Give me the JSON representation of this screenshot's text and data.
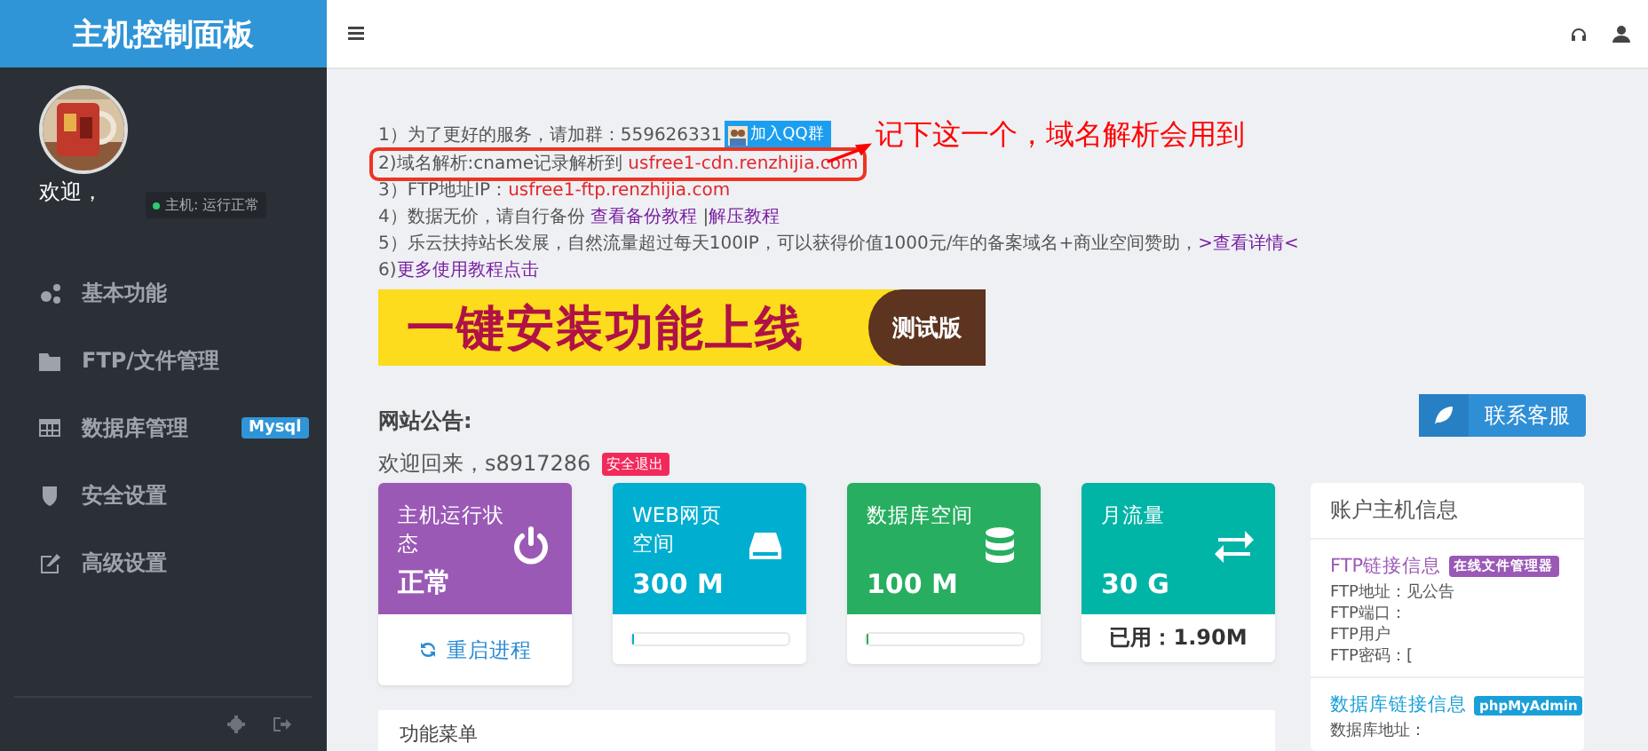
{
  "sidebar": {
    "title": "主机控制面板",
    "welcome": "欢迎，",
    "status": "主机: 运行正常",
    "items": [
      {
        "label": "基本功能"
      },
      {
        "label": "FTP/文件管理"
      },
      {
        "label": "数据库管理",
        "badge": "Mysql"
      },
      {
        "label": "安全设置"
      },
      {
        "label": "高级设置"
      }
    ]
  },
  "notices": [
    {
      "boxed": false,
      "parts": [
        {
          "kind": "text",
          "text": "1）为了更好的服务，请加群：559626331"
        },
        {
          "kind": "qq",
          "text": "加入QQ群"
        }
      ]
    },
    {
      "boxed": true,
      "parts": [
        {
          "kind": "text",
          "text": "2)域名解析:cname记录解析到 "
        },
        {
          "kind": "highlight",
          "text": "usfree1-cdn.renzhijia.com"
        }
      ]
    },
    {
      "boxed": false,
      "parts": [
        {
          "kind": "text",
          "text": "3）FTP地址IP："
        },
        {
          "kind": "highlight",
          "text": "usfree1-ftp.renzhijia.com"
        }
      ]
    },
    {
      "boxed": false,
      "parts": [
        {
          "kind": "text",
          "text": "4）数据无价，请自行备份 "
        },
        {
          "kind": "link",
          "text": "查看备份教程"
        },
        {
          "kind": "text",
          "text": " |"
        },
        {
          "kind": "link",
          "text": "解压教程"
        }
      ]
    },
    {
      "boxed": false,
      "parts": [
        {
          "kind": "text",
          "text": "5）乐云扶持站长发展，自然流量超过每天100IP，可以获得价值1000元/年的备案域名+商业空间赞助，"
        },
        {
          "kind": "link",
          "text": ">查看详情<"
        }
      ]
    },
    {
      "boxed": false,
      "parts": [
        {
          "kind": "text",
          "text": "6)"
        },
        {
          "kind": "link",
          "text": "更多使用教程点击"
        }
      ]
    }
  ],
  "annotation": "记下这一个，域名解析会用到",
  "banner": {
    "headline": "一键安装功能上线",
    "tag": "测试版"
  },
  "announcement": {
    "label": "网站公告:",
    "welcome": "欢迎回来，s8917286",
    "logout": "安全退出",
    "support_button": "联系客服"
  },
  "cards": [
    {
      "kind": "status",
      "title": "主机运行状态",
      "value": "正常",
      "footer": "重启进程",
      "color": "#9b59b6"
    },
    {
      "kind": "meter",
      "title": "WEB网页空间",
      "value": "300 M",
      "level": 0.01,
      "color": "#00aed0"
    },
    {
      "kind": "meter",
      "title": "数据库空间",
      "value": "100 M",
      "level": 0.02,
      "color": "#27ae60"
    },
    {
      "kind": "usage",
      "title": "月流量",
      "value": "30 G",
      "footer": "已用：1.90M",
      "color": "#00b5a6"
    }
  ],
  "account": {
    "title": "账户主机信息",
    "sections": [
      {
        "heading": "FTP链接信息",
        "badge": "在线文件管理器",
        "color": "#9b59b6",
        "lines": [
          "FTP地址：见公告",
          "FTP端口：",
          "FTP用户",
          "FTP密码：["
        ]
      },
      {
        "heading": "数据库链接信息",
        "badge": "phpMyAdmin",
        "color": "#1aa0d8",
        "lines": [
          "数据库地址："
        ]
      }
    ]
  },
  "menu_panel": {
    "title": "功能菜单"
  }
}
